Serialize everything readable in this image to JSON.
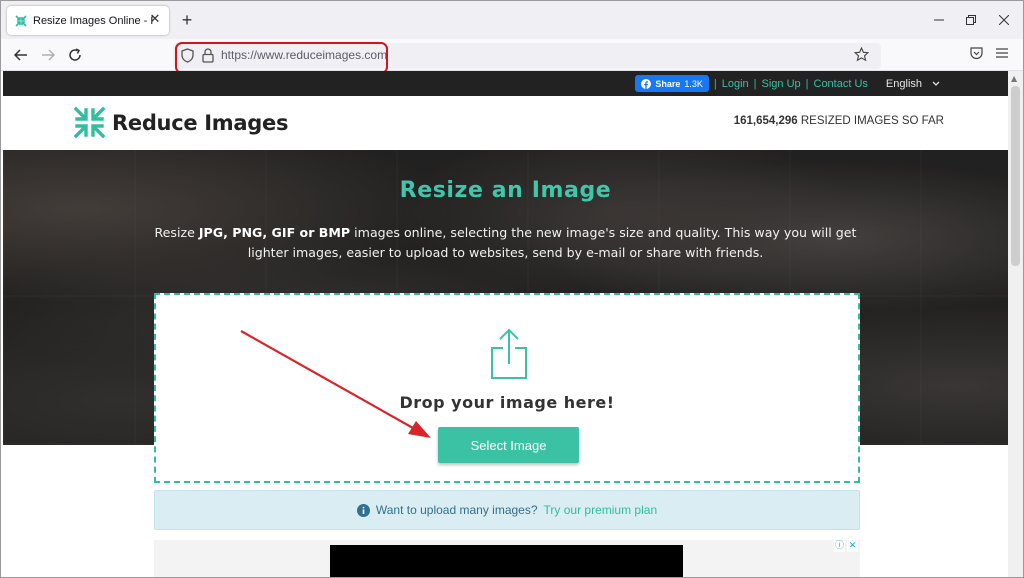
{
  "browser": {
    "tab": {
      "title": "Resize Images Online - Reduce Im"
    },
    "url": "https://www.reduceimages.com"
  },
  "site": {
    "topbar": {
      "share_label": "Share",
      "share_count": "1.3K",
      "links": [
        "Login",
        "Sign Up",
        "Contact Us"
      ],
      "language": "English"
    },
    "brand": "Reduce Images",
    "counter": {
      "number": "161,654,296",
      "label": " RESIZED IMAGES SO FAR"
    },
    "hero": {
      "title": "Resize an Image",
      "desc_prefix": "Resize ",
      "desc_formats": "JPG, PNG, GIF or BMP",
      "desc_suffix": " images online, selecting the new image's size and quality. This way you will get lighter images, easier to upload to websites, send by e-mail or share with friends."
    },
    "dropzone": {
      "text": "Drop your image here!",
      "button": "Select Image"
    },
    "info": {
      "text": "Want to upload many images?",
      "link": "Try our premium plan"
    }
  },
  "colors": {
    "accent": "#3bc2a4",
    "highlight_box": "#d0161c",
    "annotation_arrow": "#d6262a",
    "topbar_bg": "#222222",
    "info_bg": "#d9edf3"
  }
}
